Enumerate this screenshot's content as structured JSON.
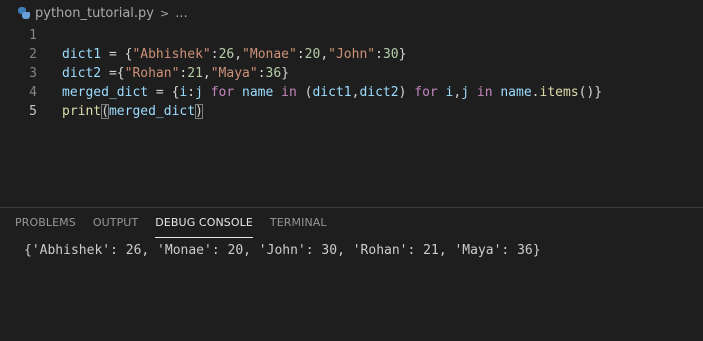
{
  "breadcrumb": {
    "file_name": "python_tutorial.py",
    "separator": ">",
    "more": "..."
  },
  "editor": {
    "line_numbers": [
      "1",
      "2",
      "3",
      "4",
      "5"
    ],
    "line2": {
      "t1": "dict1 ",
      "t2": "=",
      "t3": " {",
      "s1": "\"Abhishek\"",
      "p1": ":",
      "n1": "26",
      "c1": ",",
      "s2": "\"Monae\"",
      "p2": ":",
      "n2": "20",
      "c2": ",",
      "s3": "\"John\"",
      "p3": ":",
      "n3": "30",
      "end": "}"
    },
    "line3": {
      "t1": "dict2 ",
      "t2": "={",
      "s1": "\"Rohan\"",
      "p1": ":",
      "n1": "21",
      "c1": ",",
      "s2": "\"Maya\"",
      "p2": ":",
      "n2": "36",
      "end": "}"
    },
    "line4": {
      "t1": "merged_dict ",
      "t2": "=",
      "t3": " {",
      "t4": "i",
      "t5": ":",
      "t6": "j ",
      "kw1": "for",
      "t7": " name ",
      "kw2": "in",
      "t8": " (",
      "t9": "dict1",
      "t10": ",",
      "t11": "dict2",
      "t12": ") ",
      "kw3": "for",
      "t13": " i",
      "t14": ",",
      "t15": "j ",
      "kw4": "in",
      "t16": " name",
      "t17": ".",
      "fn1": "items",
      "t18": "()}"
    },
    "line5": {
      "fn": "print",
      "open": "(",
      "arg": "merged_dict",
      "close": ")"
    }
  },
  "panel": {
    "tabs": [
      "PROBLEMS",
      "OUTPUT",
      "DEBUG CONSOLE",
      "TERMINAL"
    ],
    "active_tab": "DEBUG CONSOLE",
    "output": "{'Abhishek': 26, 'Monae': 20, 'John': 30, 'Rohan': 21, 'Maya': 36}"
  },
  "icons": {
    "file_icon": "python-file-icon",
    "separator_icon": "chevron-right-icon"
  }
}
